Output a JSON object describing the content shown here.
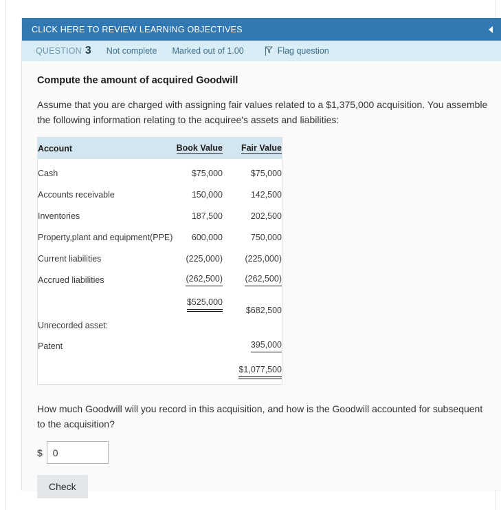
{
  "objectives_header": {
    "title": "CLICK HERE TO REVIEW LEARNING OBJECTIVES",
    "collapse_icon": "triangle-left-icon",
    "background": "#3279b3"
  },
  "info_bar": {
    "question_label": "QUESTION",
    "question_number": "3",
    "status": "Not complete",
    "marks": "Marked out of 1.00",
    "flag_label": "Flag question",
    "flag_icon": "flag-icon",
    "background": "#d9edf7"
  },
  "question": {
    "heading": "Compute the amount of acquired Goodwill",
    "intro": "Assume that you are charged with assigning fair values related to a $1,375,000 acquisition. You assemble the following information relating to the acquiree's assets and liabilities:",
    "prompt": "How much Goodwill will you record in this acquisition, and how is the Goodwill accounted for subsequent to the acquisition?"
  },
  "table": {
    "headers": [
      "Account",
      "Book Value",
      "Fair Value"
    ],
    "rows": [
      {
        "account": "Cash",
        "book_value": "$75,000",
        "fair_value": "$75,000"
      },
      {
        "account": "Accounts receivable",
        "book_value": "150,000",
        "fair_value": "142,500"
      },
      {
        "account": "Inventories",
        "book_value": "187,500",
        "fair_value": "202,500"
      },
      {
        "account": "Property,plant and equipment(PPE)",
        "book_value": "600,000",
        "fair_value": "750,000"
      },
      {
        "account": "Current liabilities",
        "book_value": "(225,000)",
        "fair_value": "(225,000)"
      },
      {
        "account": "Accrued liabilities",
        "book_value": "(262,500)",
        "fair_value": "(262,500)"
      }
    ],
    "subtotal": {
      "account": "",
      "book_value": "$525,000",
      "fair_value": "$682,500"
    },
    "unrecorded_label": "Unrecorded asset:",
    "patent": {
      "account": "Patent",
      "book_value": "",
      "fair_value": "395,000"
    },
    "grand_total": {
      "account": "",
      "book_value": "",
      "fair_value": "$1,077,500"
    }
  },
  "answer": {
    "currency_symbol": "$",
    "value": "0",
    "placeholder": ""
  },
  "actions": {
    "check_label": "Check"
  }
}
